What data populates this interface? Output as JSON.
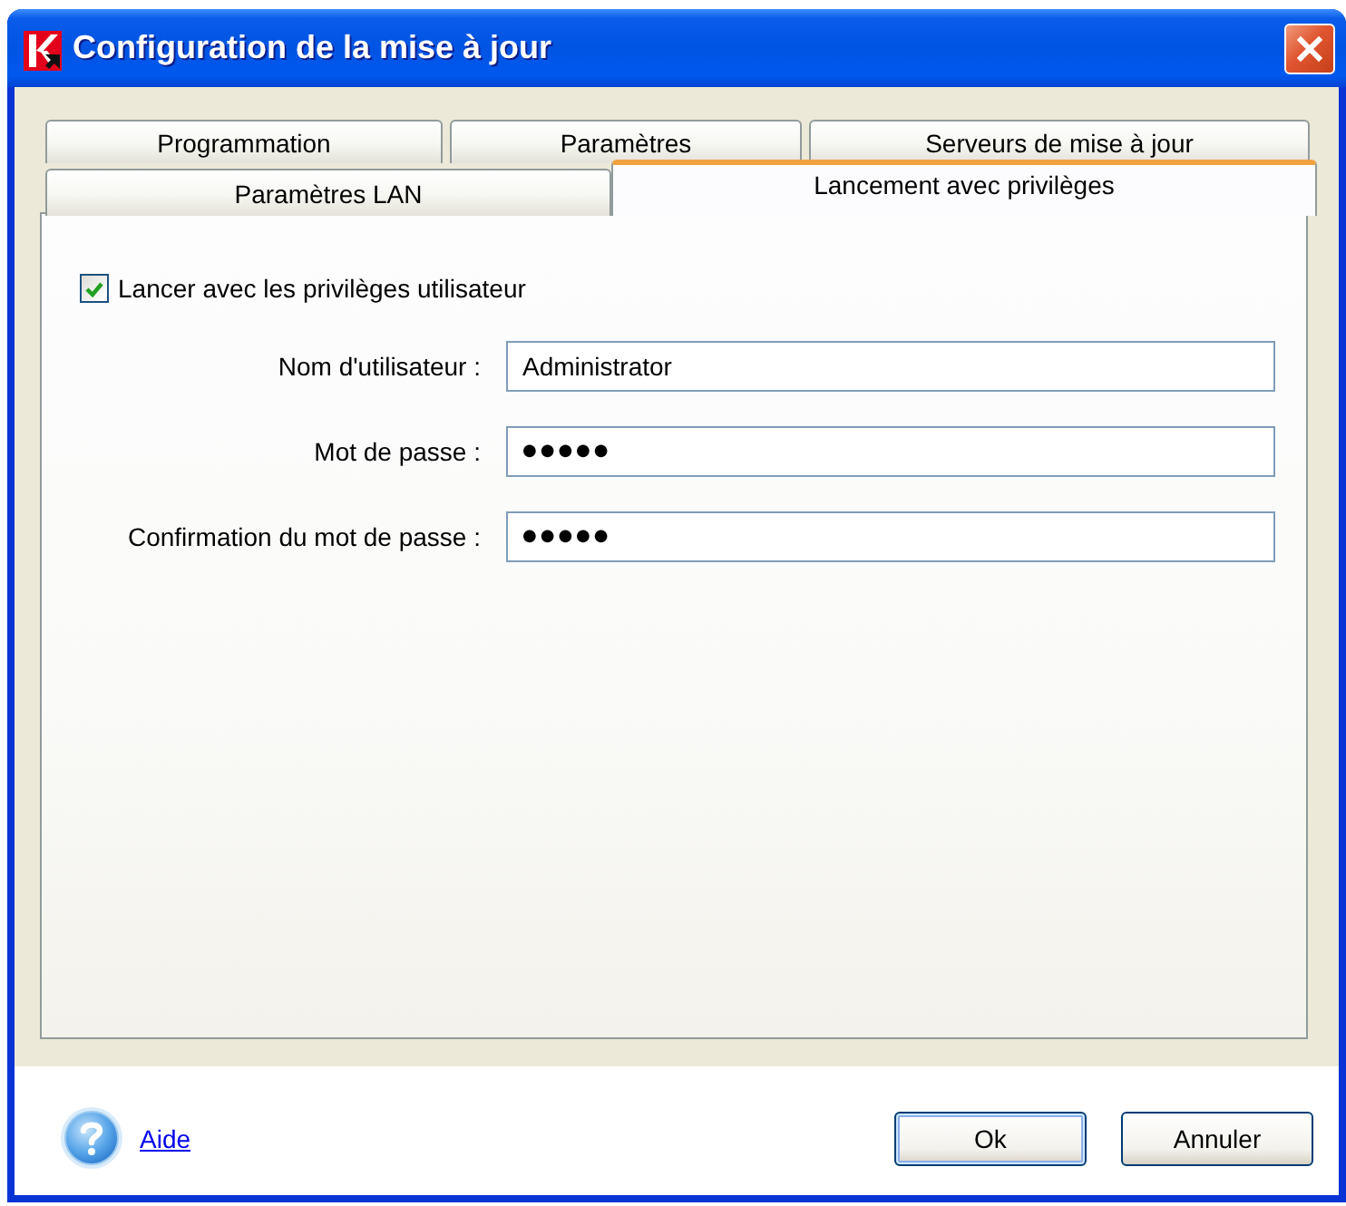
{
  "window": {
    "title": "Configuration de la mise à jour"
  },
  "tab_rows": [
    {
      "tabs": [
        {
          "label": "Programmation",
          "selected": false
        },
        {
          "label": "Paramètres",
          "selected": false
        },
        {
          "label": "Serveurs de mise à jour",
          "selected": false
        }
      ]
    },
    {
      "tabs": [
        {
          "label": "Paramètres LAN",
          "selected": false
        },
        {
          "label": "Lancement avec privilèges",
          "selected": true
        }
      ]
    }
  ],
  "panel": {
    "checkbox": {
      "label": "Lancer avec les privilèges utilisateur",
      "checked": true
    },
    "fields": [
      {
        "label": "Nom d'utilisateur :",
        "value": "Administrator",
        "kind": "text"
      },
      {
        "label": "Mot de passe :",
        "value": "●●●●●",
        "kind": "password"
      },
      {
        "label": "Confirmation du mot de passe :",
        "value": "●●●●●",
        "kind": "password"
      }
    ]
  },
  "footer": {
    "help_link": "Aide",
    "buttons": [
      {
        "label": "Ok",
        "default": true
      },
      {
        "label": "Annuler",
        "default": false
      }
    ]
  }
}
